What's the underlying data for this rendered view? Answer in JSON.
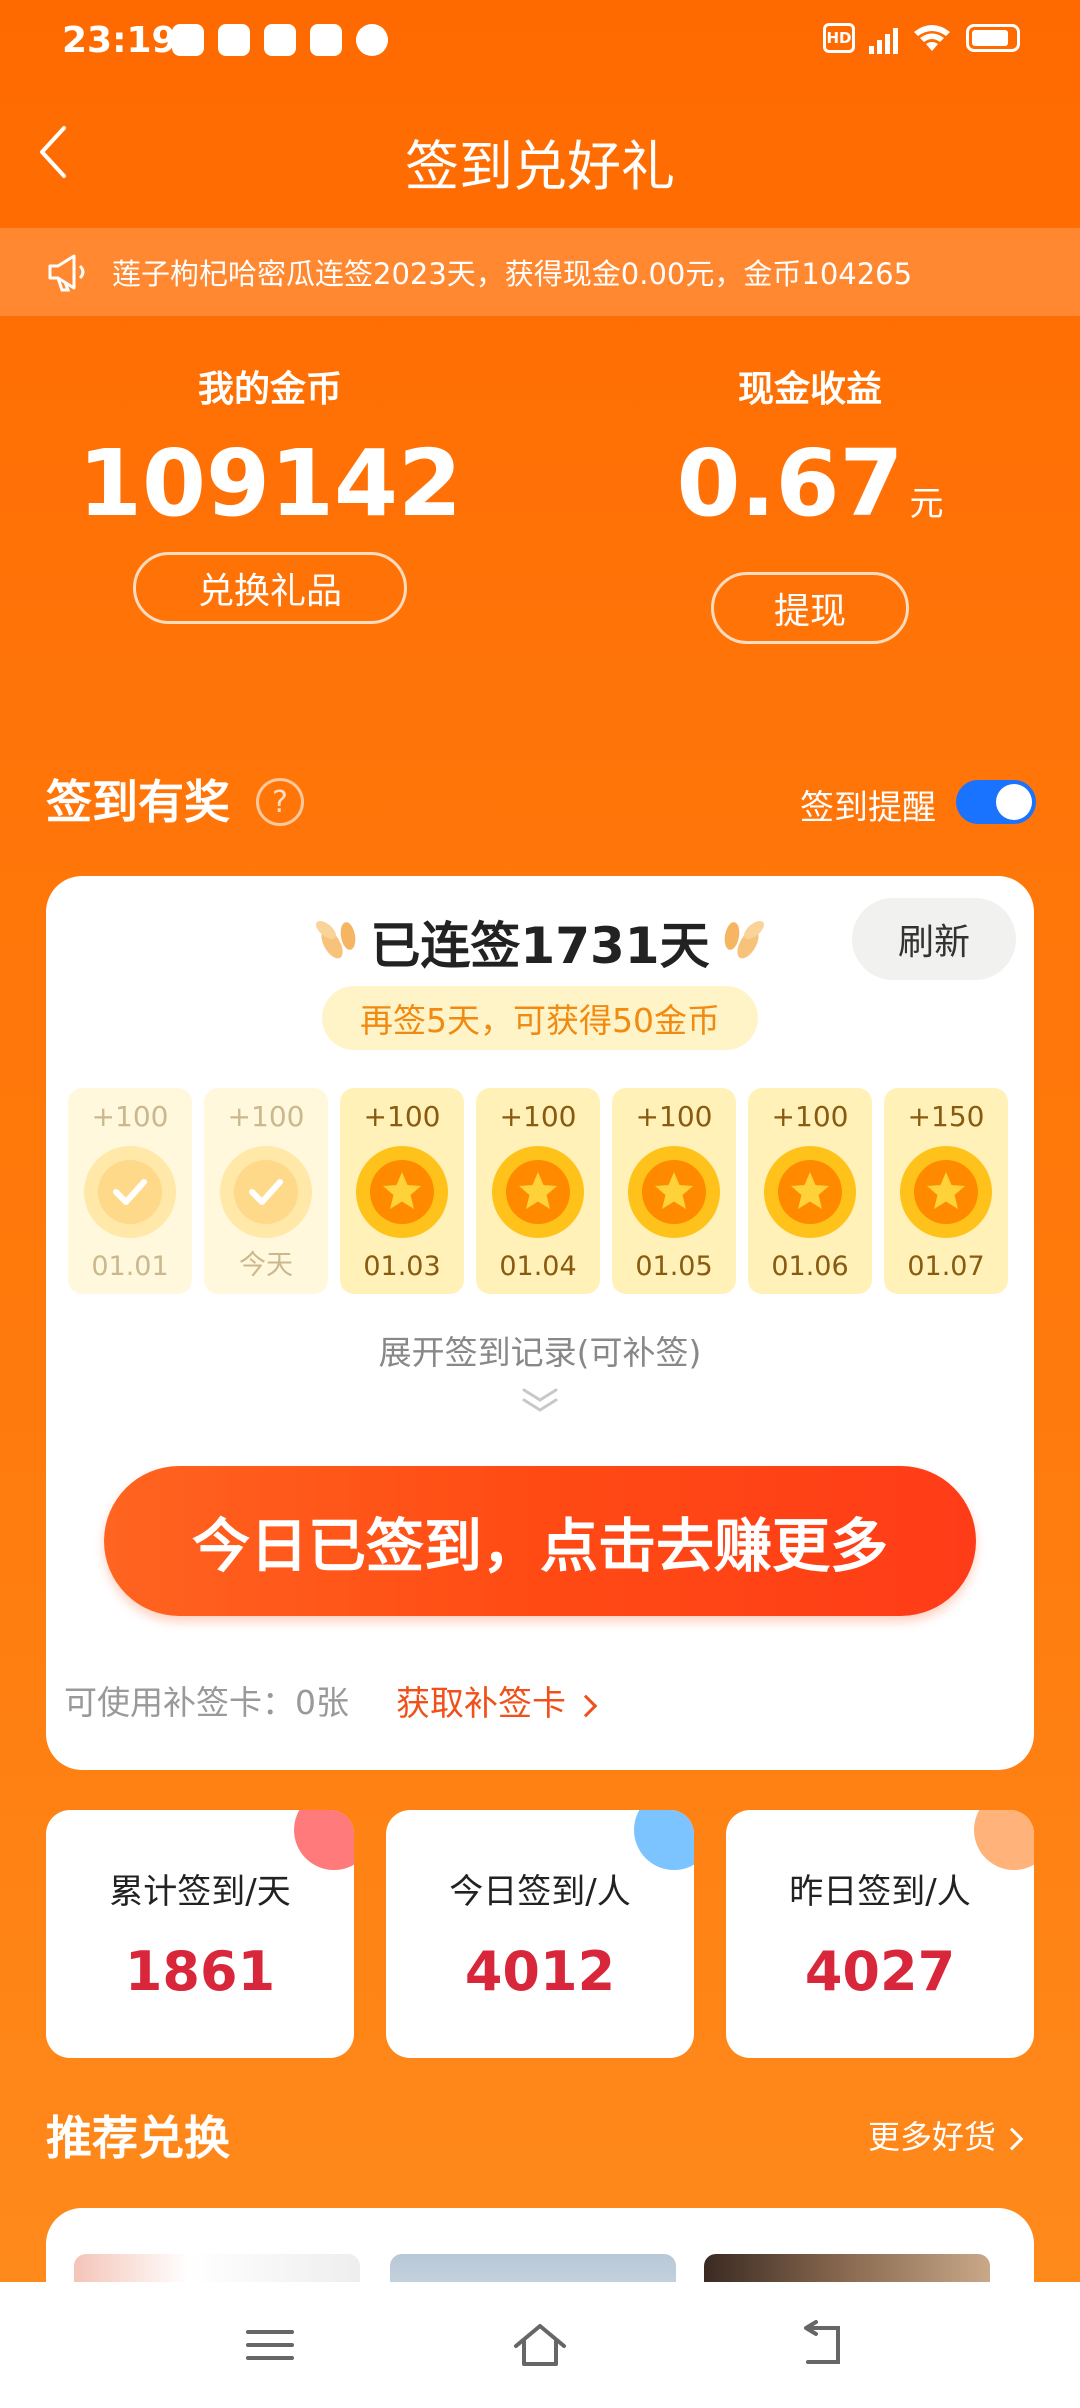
{
  "status_bar": {
    "time": "23:19",
    "hd": "HD"
  },
  "nav": {
    "title": "签到兑好礼"
  },
  "notice": {
    "text": "莲子枸杞哈密瓜连签2023天，获得现金0.00元，金币104265"
  },
  "coins": {
    "label": "我的金币",
    "value": "109142",
    "button": "兑换礼品"
  },
  "cash": {
    "label": "现金收益",
    "value": "0.67",
    "unit": "元",
    "button": "提现"
  },
  "sign_section": {
    "title": "签到有奖",
    "help": "?",
    "reminder_label": "签到提醒",
    "reminder_on": true
  },
  "card": {
    "streak": "已连签1731天",
    "refresh": "刷新",
    "tip": "再签5天，可获得50金币",
    "days": [
      {
        "reward": "+100",
        "date": "01.01",
        "done": true
      },
      {
        "reward": "+100",
        "date": "今天",
        "done": true
      },
      {
        "reward": "+100",
        "date": "01.03",
        "done": false
      },
      {
        "reward": "+100",
        "date": "01.04",
        "done": false
      },
      {
        "reward": "+100",
        "date": "01.05",
        "done": false
      },
      {
        "reward": "+100",
        "date": "01.06",
        "done": false
      },
      {
        "reward": "+150",
        "date": "01.07",
        "done": false
      }
    ],
    "expand": "展开签到记录(可补签)",
    "cta": "今日已签到，点击去赚更多",
    "makeup_cards": "可使用补签卡：0张",
    "get_makeup": "获取补签卡"
  },
  "stats": [
    {
      "label": "累计签到/天",
      "value": "1861",
      "color": "#ff7a7a"
    },
    {
      "label": "今日签到/人",
      "value": "4012",
      "color": "#7cc4ff"
    },
    {
      "label": "昨日签到/人",
      "value": "4027",
      "color": "#ffb27a"
    }
  ],
  "recommend": {
    "title": "推荐兑换",
    "more": "更多好货"
  },
  "colors": {
    "accent": "#ff6a00",
    "cta": "#ff4a14",
    "stat_value": "#d8263a",
    "toggle": "#1a73ff"
  }
}
